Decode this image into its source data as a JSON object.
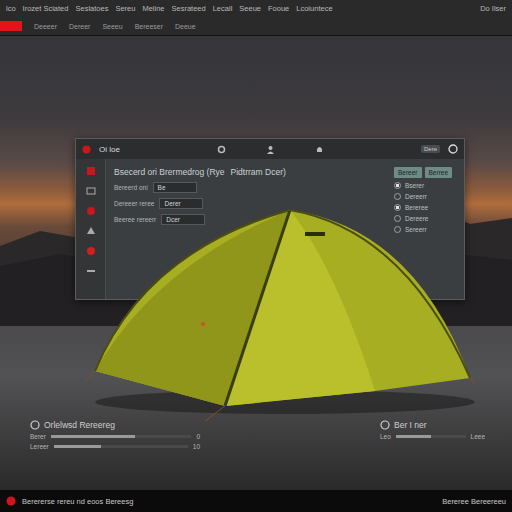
{
  "menu": {
    "items": [
      "lco",
      "Irozet Sciated",
      "Seslatoes",
      "Sereu",
      "Meiine",
      "Sesrateed",
      "Lecall",
      "Seeue",
      "Fooue",
      "Lcoiuntece"
    ],
    "account": "Do Ilser"
  },
  "toolbar": {
    "items": [
      "Deeeer",
      "Dereer",
      "Seeeu",
      "Bereeser",
      "Deeue"
    ]
  },
  "window": {
    "title": "Oi loe",
    "badge": "Dere",
    "heading": "Bsecerd ori Brermedrog (Rye",
    "heading_right": "Pidtrram Dcer)",
    "buttons": [
      "Bereer",
      "Berree"
    ],
    "fields": [
      {
        "label": "Bereerd oni",
        "value": "Be"
      },
      {
        "label": "Dereeer reree",
        "value": "Derer"
      },
      {
        "label": "Beeree rereerr",
        "value": "Dcer"
      }
    ],
    "options": [
      {
        "label": "Bserer",
        "checked": true
      },
      {
        "label": "Dereerr",
        "checked": false
      },
      {
        "label": "Bereree",
        "checked": true
      },
      {
        "label": "Dereere",
        "checked": false
      },
      {
        "label": "Sereerr",
        "checked": false
      }
    ]
  },
  "panels": [
    {
      "title": "Orlelwsd Rereereg",
      "rows": [
        {
          "label": "Berer",
          "reading": "0",
          "level": 0.6
        },
        {
          "label": "Lereer",
          "reading": "10",
          "level": 0.35
        }
      ]
    },
    {
      "title": "Ber I ner",
      "rows": [
        {
          "label": "Leo",
          "reading": "Leee",
          "level": 0.5
        }
      ]
    }
  ],
  "status_bar": {
    "left": "Berererse rereu nd eoos Bereesg",
    "right": "Bereree Bereereeu"
  }
}
